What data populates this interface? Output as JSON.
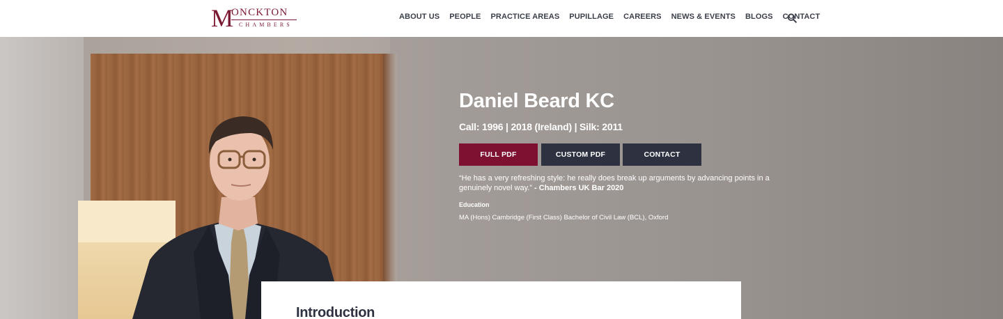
{
  "logo": {
    "initial": "M",
    "top_text": "ONCKTON",
    "bottom_text": "CHAMBERS",
    "brand_color": "#7a1832"
  },
  "nav": {
    "items": [
      {
        "label": "ABOUT US"
      },
      {
        "label": "PEOPLE"
      },
      {
        "label": "PRACTICE AREAS"
      },
      {
        "label": "PUPILLAGE"
      },
      {
        "label": "CAREERS"
      },
      {
        "label": "NEWS & EVENTS"
      },
      {
        "label": "BLOGS"
      },
      {
        "label": "CONTACT"
      }
    ],
    "search_icon": "search-icon"
  },
  "profile": {
    "name": "Daniel Beard KC",
    "call": "Call: 1996 | 2018 (Ireland) | Silk: 2011",
    "buttons": {
      "full_pdf": "FULL PDF",
      "custom_pdf": "CUSTOM PDF",
      "contact": "CONTACT"
    },
    "quote_text": "“He has a very refreshing style: he really does break up arguments by advancing points in a genuinely novel way.”",
    "quote_source": "- Chambers UK Bar 2020",
    "education_label": "Education",
    "education_text": "MA (Hons) Cambridge (First Class) Bachelor of Civil Law (BCL), Oxford"
  },
  "intro": {
    "title": "Introduction"
  },
  "colors": {
    "accent": "#7e1031",
    "dark_button": "#2e3140",
    "nav_text": "#3b3f4a"
  }
}
